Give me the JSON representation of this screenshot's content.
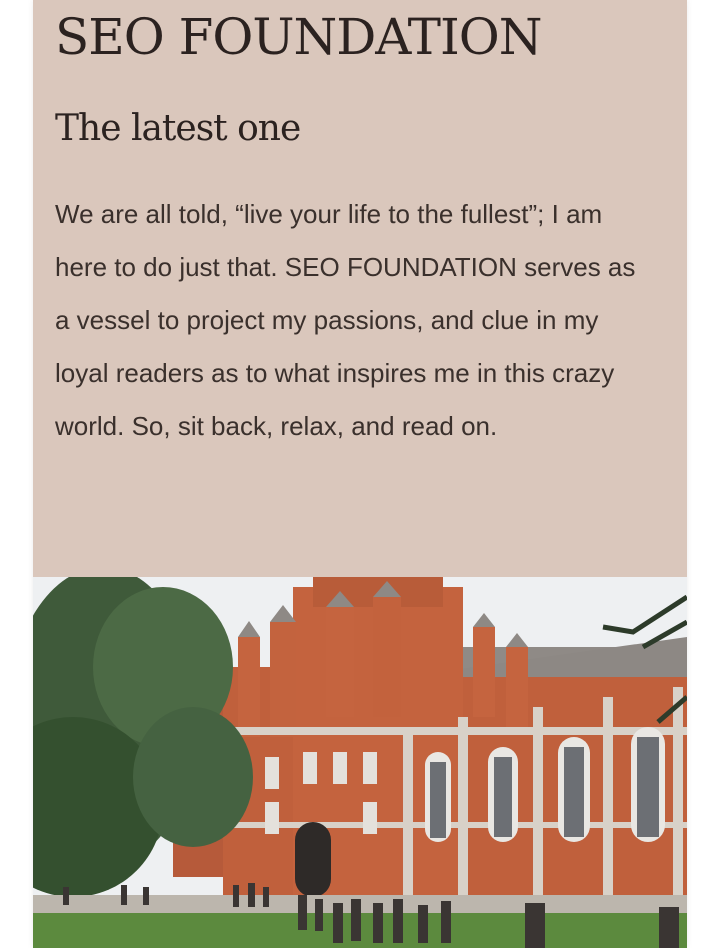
{
  "site": {
    "title": "SEO FOUNDATION"
  },
  "post": {
    "title": "The latest one",
    "body": "We are all told, “live your life to the fullest”; I am here to do just that. SEO FOUNDATION serves as a vessel to project my passions, and clue in my loyal readers as to what inspires me in this crazy world. So, sit back, relax, and read on."
  },
  "colors": {
    "card_background": "#dac7bc",
    "text": "#2b2220",
    "brick": "#c0603c"
  },
  "hero_image": {
    "subject": "red brick university building with trees and students on lawn"
  }
}
